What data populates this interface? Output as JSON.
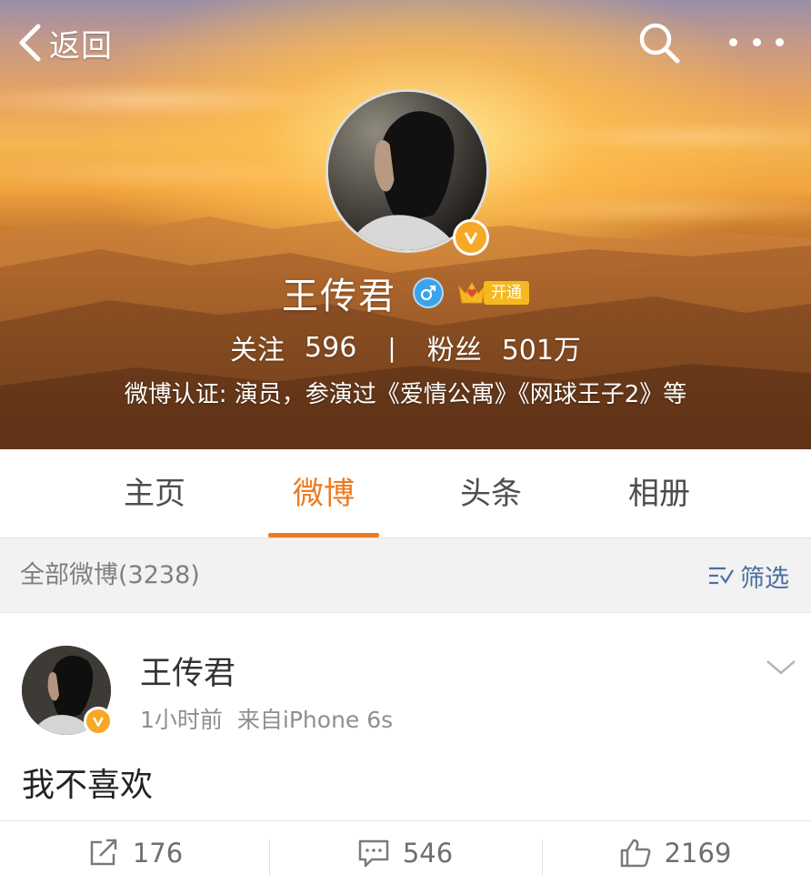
{
  "nav": {
    "back_label": "返回"
  },
  "profile": {
    "name": "王传君",
    "vip_label": "开通",
    "following_label": "关注",
    "following_count": "596",
    "stat_separator": "|",
    "followers_label": "粉丝",
    "followers_count": "501万",
    "verification": "微博认证: 演员，参演过《爱情公寓》《网球王子2》等"
  },
  "tabs": [
    {
      "label": "主页"
    },
    {
      "label": "微博",
      "active": true
    },
    {
      "label": "头条"
    },
    {
      "label": "相册"
    }
  ],
  "filter": {
    "title": "全部微博(3238)",
    "button_label": "筛选"
  },
  "post": {
    "author": "王传君",
    "time": "1小时前",
    "source": "来自iPhone 6s",
    "text": "我不喜欢",
    "reposts": "176",
    "comments": "546",
    "likes": "2169"
  },
  "colors": {
    "accent": "#eb7b22",
    "verified": "#f7a824",
    "gender_male": "#3aa3ec",
    "link": "#4a6fa0"
  },
  "icons": [
    "chevron-left-icon",
    "search-icon",
    "more-icon",
    "verified-icon",
    "male-icon",
    "crown-icon",
    "filter-icon",
    "chevron-down-icon",
    "repost-icon",
    "comment-icon",
    "like-icon"
  ]
}
